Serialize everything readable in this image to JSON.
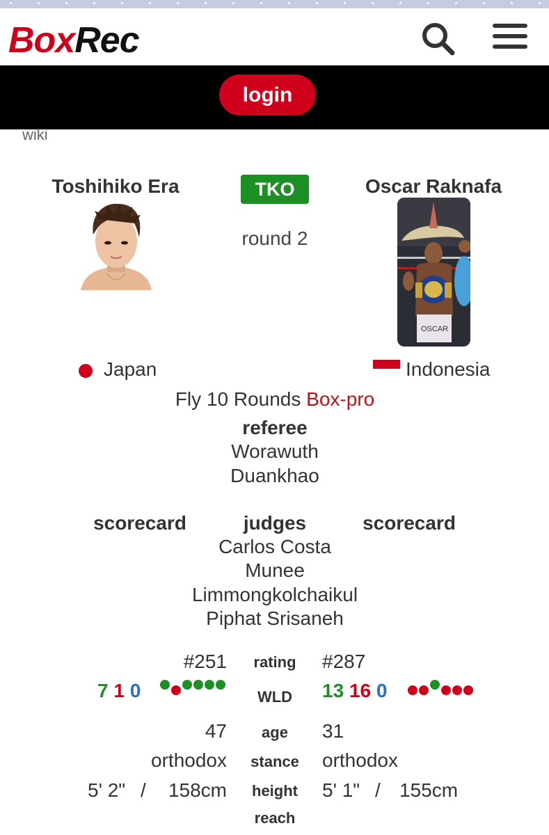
{
  "header": {
    "logo_part1": "Box",
    "logo_part2": "Rec",
    "search_icon": "search-icon",
    "menu_icon": "hamburger-menu-icon",
    "login_label": "login"
  },
  "breadcrumb": {
    "wiki": "wiki"
  },
  "bout": {
    "result": "TKO",
    "round": "round 2",
    "division_text": "Fly 10 Rounds",
    "sanction_link": "Box-pro",
    "referee_label": "referee",
    "referee_line1": "Worawuth",
    "referee_line2": "Duankhao",
    "scorecard_left": "scorecard",
    "judges_label": "judges",
    "scorecard_right": "scorecard",
    "judges": [
      "Carlos Costa",
      "Munee",
      "Limmongkolchaikul",
      "Piphat Srisaneh"
    ]
  },
  "boxer_a": {
    "name": "Toshihiko Era",
    "country": "Japan",
    "rating": "#251",
    "wins": "7",
    "losses": "1",
    "draws": "0",
    "last6": [
      "W",
      "L",
      "W",
      "W",
      "W",
      "W"
    ],
    "age": "47",
    "stance": "orthodox",
    "height_imperial": "5' 2\"",
    "height_separator": "/",
    "height_metric": "158cm"
  },
  "boxer_b": {
    "name": "Oscar Raknafa",
    "country": "Indonesia",
    "rating": "#287",
    "wins": "13",
    "losses": "16",
    "draws": "0",
    "last6": [
      "L",
      "L",
      "W",
      "L",
      "L",
      "L"
    ],
    "age": "31",
    "stance": "orthodox",
    "height_imperial": "5' 1\"",
    "height_separator": "/",
    "height_metric": "155cm"
  },
  "labels": {
    "rating": "rating",
    "wld": "WLD",
    "age": "age",
    "stance": "stance",
    "height": "height",
    "reach": "reach"
  },
  "colors": {
    "brand_red": "#d0021b",
    "win_green": "#1c8f25",
    "draw_blue": "#2b6fce"
  }
}
